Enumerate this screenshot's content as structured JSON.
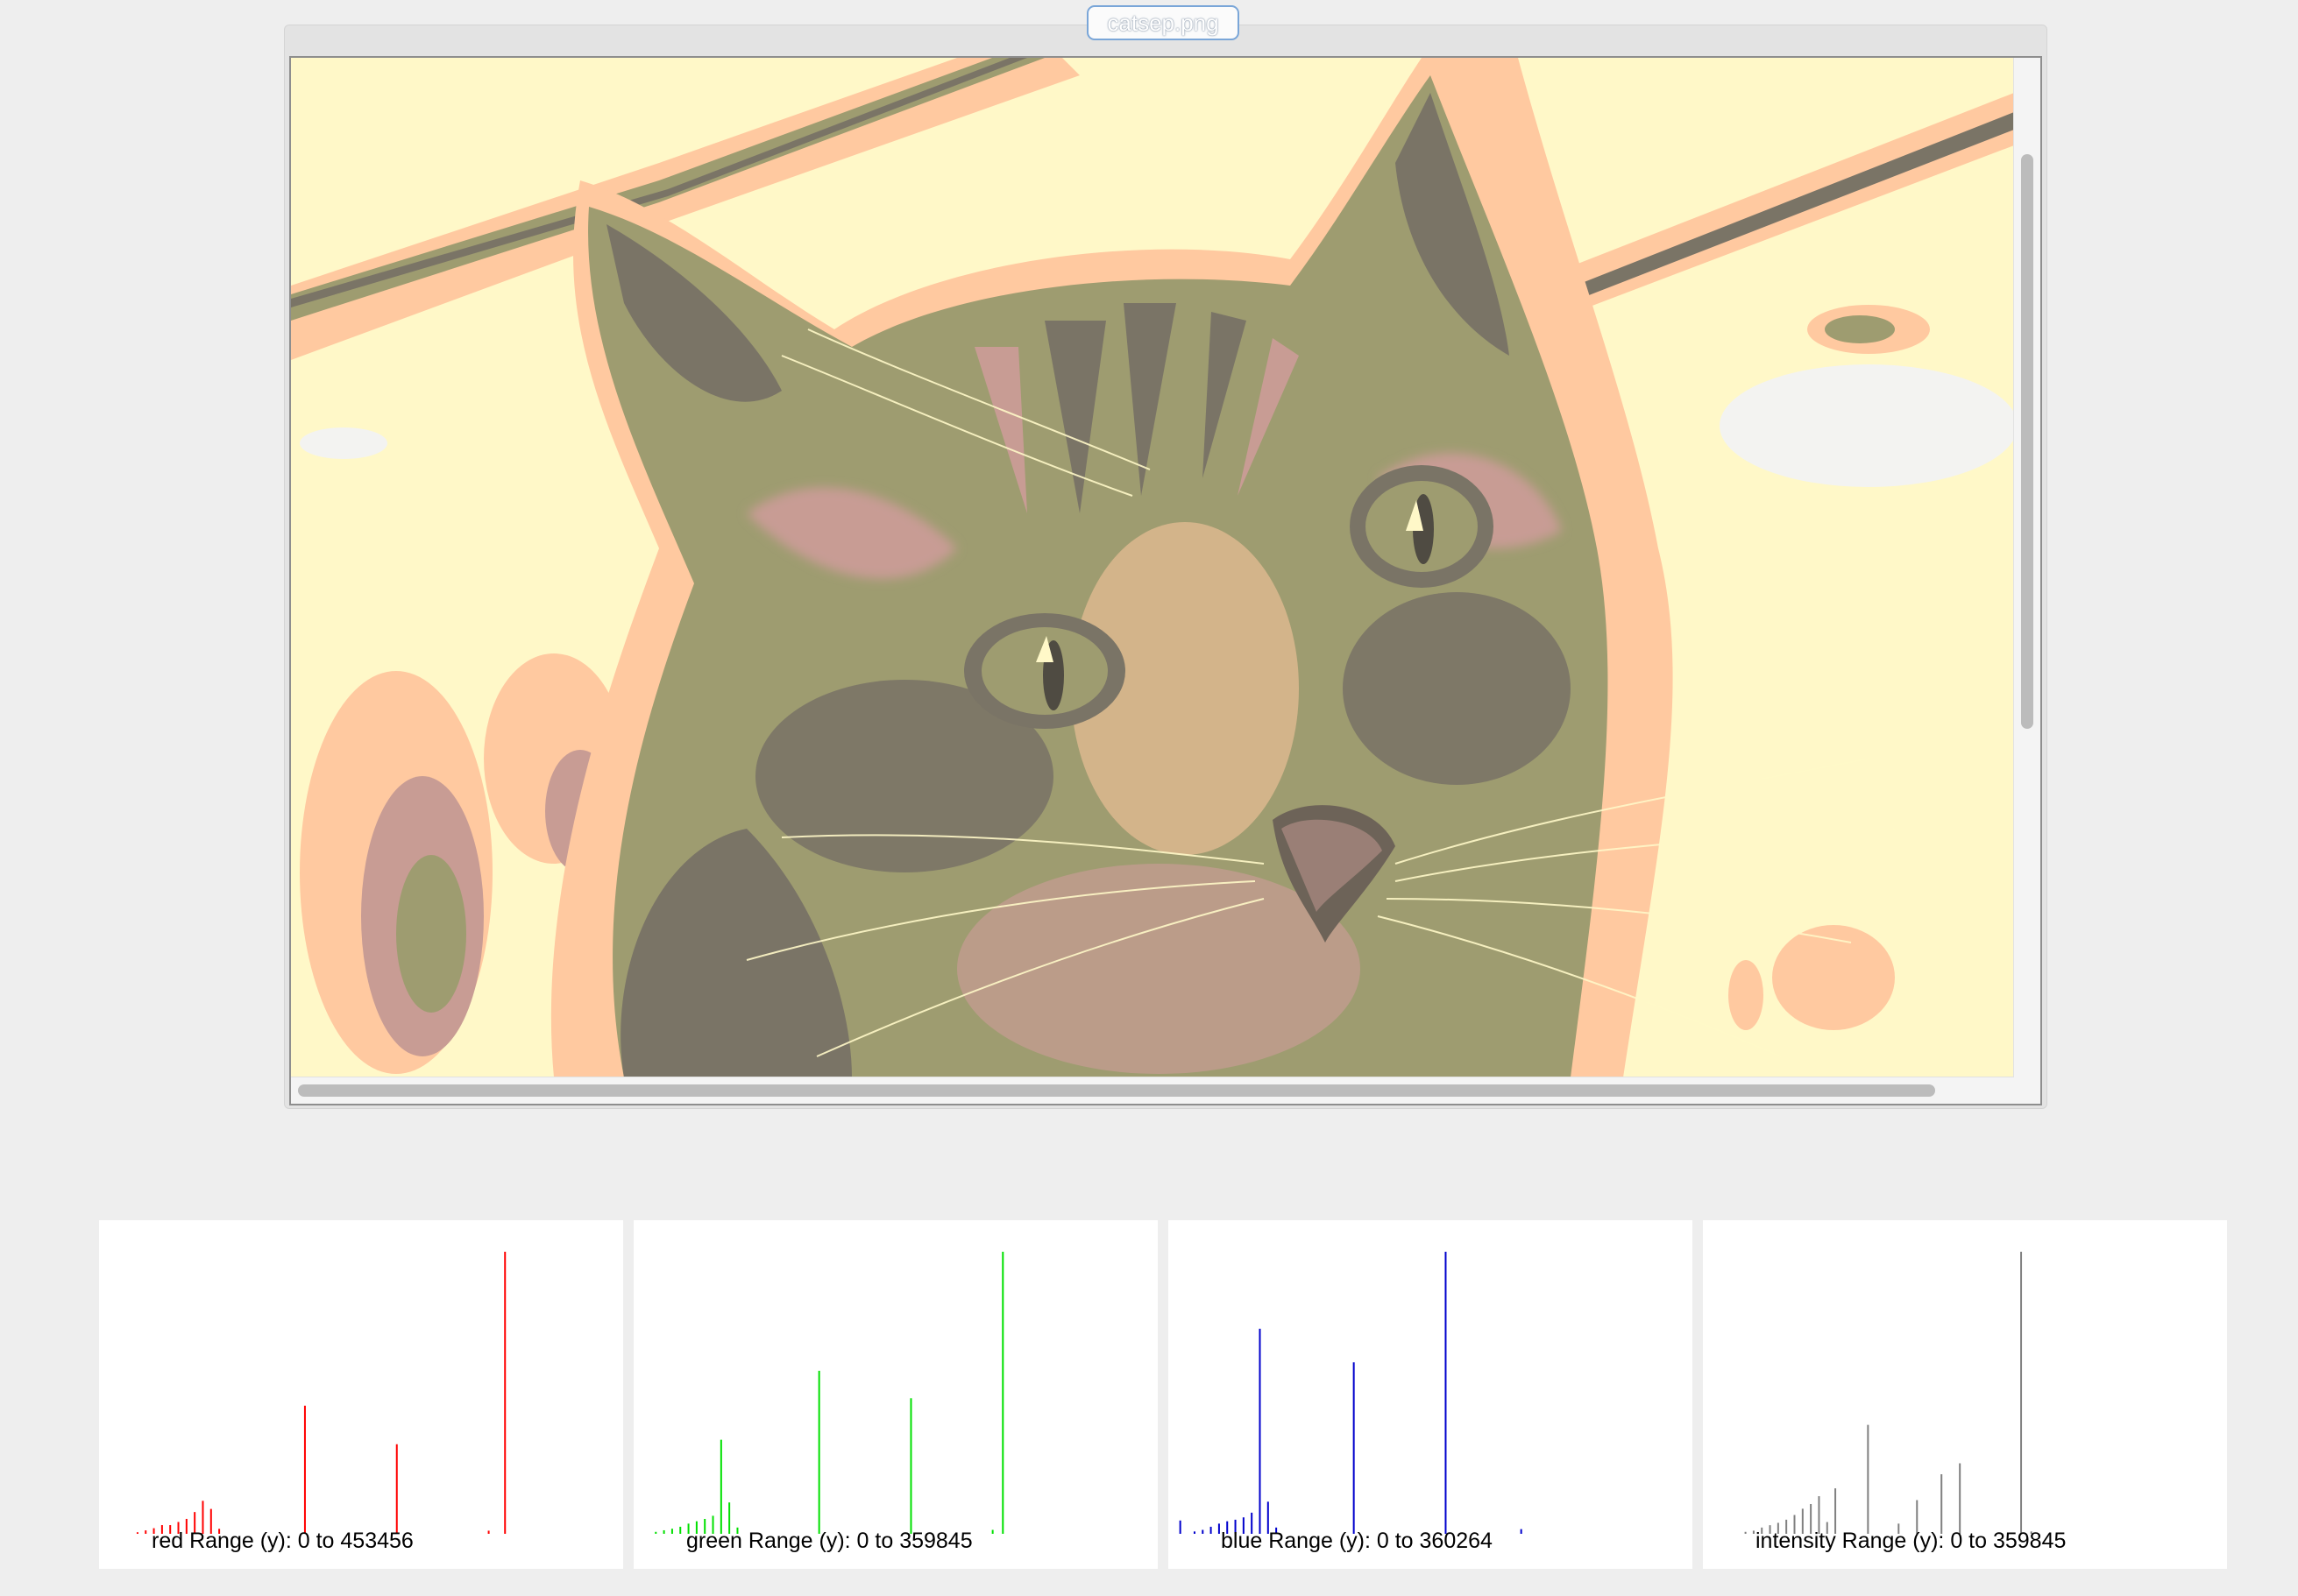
{
  "viewer": {
    "file_name": "catsep.png"
  },
  "colors": {
    "background": "#eeeeee",
    "image_palette": [
      "#fff8c8",
      "#ffc9a0",
      "#c89c94",
      "#9e9c70",
      "#7a7466",
      "#f3f3f1"
    ]
  },
  "histograms": [
    {
      "channel": "red",
      "label": "red Range (y): 0 to 453456",
      "color": "#ff0000",
      "y_range": [
        0,
        453456
      ],
      "bins": [
        {
          "bin": 18,
          "value": 2500
        },
        {
          "bin": 22,
          "value": 5500
        },
        {
          "bin": 26,
          "value": 9000
        },
        {
          "bin": 30,
          "value": 14000
        },
        {
          "bin": 34,
          "value": 14000
        },
        {
          "bin": 38,
          "value": 19000
        },
        {
          "bin": 42,
          "value": 24000
        },
        {
          "bin": 46,
          "value": 35000
        },
        {
          "bin": 50,
          "value": 53000
        },
        {
          "bin": 54,
          "value": 40000
        },
        {
          "bin": 58,
          "value": 8000
        },
        {
          "bin": 100,
          "value": 206000
        },
        {
          "bin": 145,
          "value": 144000
        },
        {
          "bin": 190,
          "value": 5000
        },
        {
          "bin": 198,
          "value": 453456
        }
      ]
    },
    {
      "channel": "green",
      "label": "green Range (y): 0 to 359845",
      "color": "#00e000",
      "y_range": [
        0,
        359845
      ],
      "bins": [
        {
          "bin": 10,
          "value": 2500
        },
        {
          "bin": 14,
          "value": 4500
        },
        {
          "bin": 18,
          "value": 6500
        },
        {
          "bin": 22,
          "value": 9000
        },
        {
          "bin": 26,
          "value": 13000
        },
        {
          "bin": 30,
          "value": 16000
        },
        {
          "bin": 34,
          "value": 19000
        },
        {
          "bin": 38,
          "value": 23000
        },
        {
          "bin": 42,
          "value": 120000
        },
        {
          "bin": 46,
          "value": 40000
        },
        {
          "bin": 50,
          "value": 8000
        },
        {
          "bin": 90,
          "value": 208000
        },
        {
          "bin": 135,
          "value": 173000
        },
        {
          "bin": 175,
          "value": 5000
        },
        {
          "bin": 180,
          "value": 359845
        }
      ]
    },
    {
      "channel": "blue",
      "label": "blue Range (y): 0 to 360264",
      "color": "#0000cc",
      "y_range": [
        0,
        360264
      ],
      "bins": [
        {
          "bin": 5,
          "value": 17000
        },
        {
          "bin": 12,
          "value": 3000
        },
        {
          "bin": 16,
          "value": 5000
        },
        {
          "bin": 20,
          "value": 9000
        },
        {
          "bin": 24,
          "value": 13000
        },
        {
          "bin": 28,
          "value": 16000
        },
        {
          "bin": 32,
          "value": 18000
        },
        {
          "bin": 36,
          "value": 21000
        },
        {
          "bin": 40,
          "value": 27000
        },
        {
          "bin": 44,
          "value": 262000
        },
        {
          "bin": 48,
          "value": 41000
        },
        {
          "bin": 52,
          "value": 8000
        },
        {
          "bin": 90,
          "value": 219000
        },
        {
          "bin": 135,
          "value": 360264
        },
        {
          "bin": 172,
          "value": 6000
        }
      ]
    },
    {
      "channel": "intensity",
      "label": "intensity Range (y): 0 to 359845",
      "color": "#808080",
      "y_range": [
        0,
        359845
      ],
      "bins": [
        {
          "bin": 20,
          "value": 2500
        },
        {
          "bin": 24,
          "value": 4000
        },
        {
          "bin": 28,
          "value": 8000
        },
        {
          "bin": 32,
          "value": 11000
        },
        {
          "bin": 36,
          "value": 14000
        },
        {
          "bin": 40,
          "value": 18000
        },
        {
          "bin": 44,
          "value": 24000
        },
        {
          "bin": 48,
          "value": 32000
        },
        {
          "bin": 52,
          "value": 38000
        },
        {
          "bin": 56,
          "value": 48000
        },
        {
          "bin": 60,
          "value": 15000
        },
        {
          "bin": 64,
          "value": 58000
        },
        {
          "bin": 80,
          "value": 139000
        },
        {
          "bin": 95,
          "value": 13000
        },
        {
          "bin": 104,
          "value": 43000
        },
        {
          "bin": 116,
          "value": 76000
        },
        {
          "bin": 125,
          "value": 90000
        },
        {
          "bin": 155,
          "value": 359845
        },
        {
          "bin": 160,
          "value": 3000
        }
      ]
    }
  ]
}
